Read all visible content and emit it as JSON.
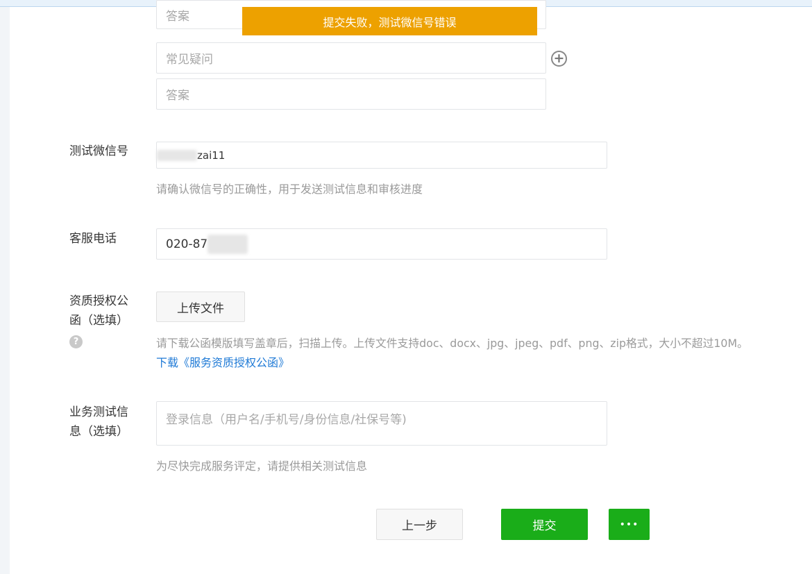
{
  "faq": {
    "answer_placeholder_1": "答案",
    "question_placeholder": "常见疑问",
    "answer_placeholder_2": "答案"
  },
  "toast": {
    "text": "提交失败，测试微信号错误"
  },
  "wechat": {
    "label": "测试微信号",
    "value_visible": "zai11",
    "tip": "请确认微信号的正确性，用于发送测试信息和审核进度"
  },
  "phone": {
    "label": "客服电话",
    "value_visible": "020-87"
  },
  "authorization": {
    "label": "资质授权公函（选填）",
    "upload_button": "上传文件",
    "tip": "请下载公函模版填写盖章后，扫描上传。上传文件支持doc、docx、jpg、jpeg、pdf、png、zip格式，大小不超过10M。",
    "download_link": "下载《服务资质授权公函》"
  },
  "business_test": {
    "label": "业务测试信息（选填）",
    "placeholder": "登录信息（用户名/手机号/身份信息/社保号等)",
    "tip": "为尽快完成服务评定，请提供相关测试信息"
  },
  "actions": {
    "prev_label": "上一步",
    "submit_label": "提交",
    "more_label": "•••"
  },
  "colors": {
    "toast_bg": "#eda100",
    "primary": "#1aad19",
    "link": "#1f7ad6"
  }
}
